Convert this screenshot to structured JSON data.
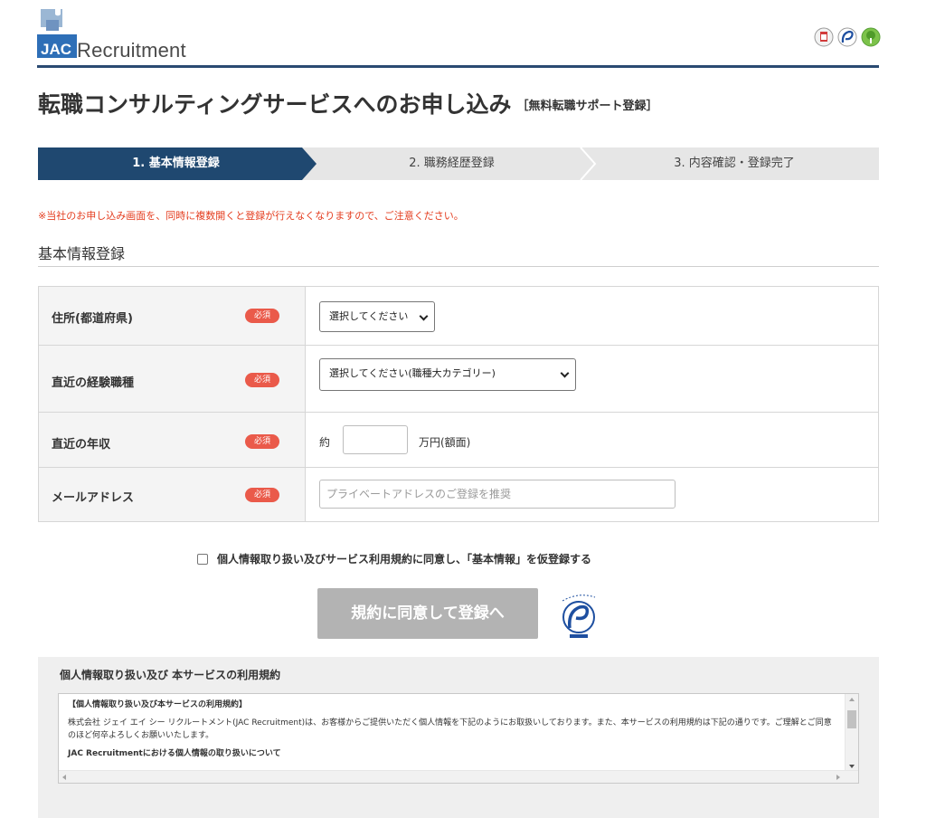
{
  "brand": {
    "logo_mark": "JAC",
    "logo_text": "Recruitment",
    "accent_color": "#2a4a72",
    "badge_icons": [
      "privacy-seal-icon",
      "pmark-icon",
      "eco-badge-icon"
    ]
  },
  "page": {
    "title": "転職コンサルティングサービスへのお申し込み",
    "subtitle": "［無料転職サポート登録］"
  },
  "steps": [
    {
      "label": "1. 基本情報登録",
      "active": true
    },
    {
      "label": "2. 職務経歴登録",
      "active": false
    },
    {
      "label": "3. 内容確認・登録完了",
      "active": false
    }
  ],
  "notice": "※当社のお申し込み画面を、同時に複数開くと登録が行えなくなりますので、ご注意ください。",
  "section_title": "基本情報登録",
  "required_label": "必須",
  "form": {
    "prefecture": {
      "label": "住所(都道府県)",
      "selected": "選択してください"
    },
    "job_category": {
      "label": "直近の経験職種",
      "selected": "選択してください(職種大カテゴリー)"
    },
    "income": {
      "label": "直近の年収",
      "prefix": "約",
      "value": "",
      "suffix": "万円(額面)"
    },
    "email": {
      "label": "メールアドレス",
      "value": "",
      "placeholder": "プライベートアドレスのご登録を推奨"
    }
  },
  "agree_label": "個人情報取り扱い及びサービス利用規約に同意し、「基本情報」を仮登録する",
  "submit_label": "規約に同意して登録へ",
  "terms": {
    "title": "個人情報取り扱い及び 本サービスの利用規約",
    "heading": "【個人情報取り扱い及び本サービスの利用規約】",
    "body": "株式会社 ジェイ エイ シー リクルートメント(JAC Recruitment)は、お客様からご提供いただく個人情報を下記のようにお取扱いしております。また、本サービスの利用規約は下記の通りです。ご理解とご同意のほど何卒よろしくお願いいたします。",
    "subheading": "JAC Recruitmentにおける個人情報の取り扱いについて"
  }
}
